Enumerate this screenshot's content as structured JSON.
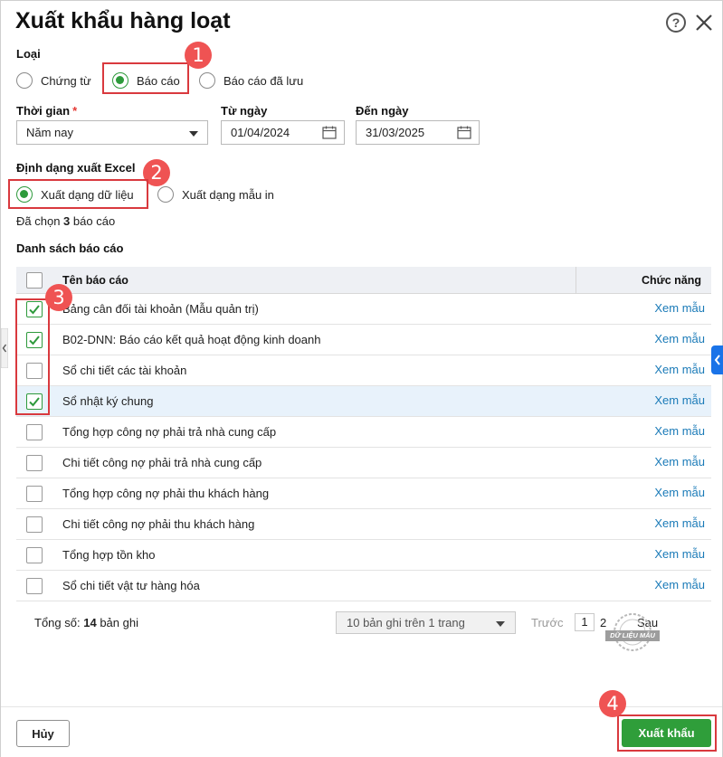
{
  "dialog": {
    "title": "Xuất khẩu hàng loạt",
    "help_icon": "question-circle-icon",
    "close_icon": "close-icon"
  },
  "type_section": {
    "label": "Loại",
    "options": [
      "Chứng từ",
      "Báo cáo",
      "Báo cáo đã lưu"
    ],
    "selected": "Báo cáo"
  },
  "time_section": {
    "label": "Thời gian",
    "required_mark": "*",
    "period_value": "Năm nay",
    "from_label": "Từ ngày",
    "from_value": "01/04/2024",
    "to_label": "Đến ngày",
    "to_value": "31/03/2025"
  },
  "format_section": {
    "label": "Định dạng xuất Excel",
    "options": [
      "Xuất dạng dữ liệu",
      "Xuất dạng mẫu in"
    ],
    "selected": "Xuất dạng dữ liệu"
  },
  "selection_info": {
    "prefix": "Đã chọn",
    "count": "3",
    "suffix": "báo cáo"
  },
  "report_list": {
    "label": "Danh sách báo cáo",
    "columns": [
      "Tên báo cáo",
      "Chức năng"
    ],
    "link_label": "Xem mẫu",
    "rows": [
      {
        "name": "Bảng cân đối tài khoản (Mẫu quản trị)",
        "checked": true
      },
      {
        "name": "B02-DNN: Báo cáo kết quả hoạt động kinh doanh",
        "checked": true
      },
      {
        "name": "Sổ chi tiết các tài khoản",
        "checked": false
      },
      {
        "name": "Sổ nhật ký chung",
        "checked": true
      },
      {
        "name": "Tổng hợp công nợ phải trả nhà cung cấp",
        "checked": false
      },
      {
        "name": "Chi tiết công nợ phải trả nhà cung cấp",
        "checked": false
      },
      {
        "name": "Tổng hợp công nợ phải thu khách hàng",
        "checked": false
      },
      {
        "name": "Chi tiết công nợ phải thu khách hàng",
        "checked": false
      },
      {
        "name": "Tổng hợp tồn kho",
        "checked": false
      },
      {
        "name": "Sổ chi tiết vật tư hàng hóa",
        "checked": false
      }
    ]
  },
  "pagination": {
    "total_prefix": "Tổng số:",
    "total_count": "14",
    "total_suffix": "bản ghi",
    "page_size": "10 bản ghi trên 1 trang",
    "prev_label": "Trước",
    "pages": [
      "1",
      "2"
    ],
    "next_label": "Sau",
    "stamp_text": "DỮ LIỆU MẪU"
  },
  "callouts": [
    "1",
    "2",
    "3",
    "4"
  ],
  "actions": {
    "cancel_label": "Hủy",
    "export_label": "Xuất khẩu"
  },
  "colors": {
    "accent_green": "#2f9e3a",
    "link_blue": "#1b7bb8",
    "callout_red": "#ef5353",
    "highlight_border": "#d9393e"
  }
}
